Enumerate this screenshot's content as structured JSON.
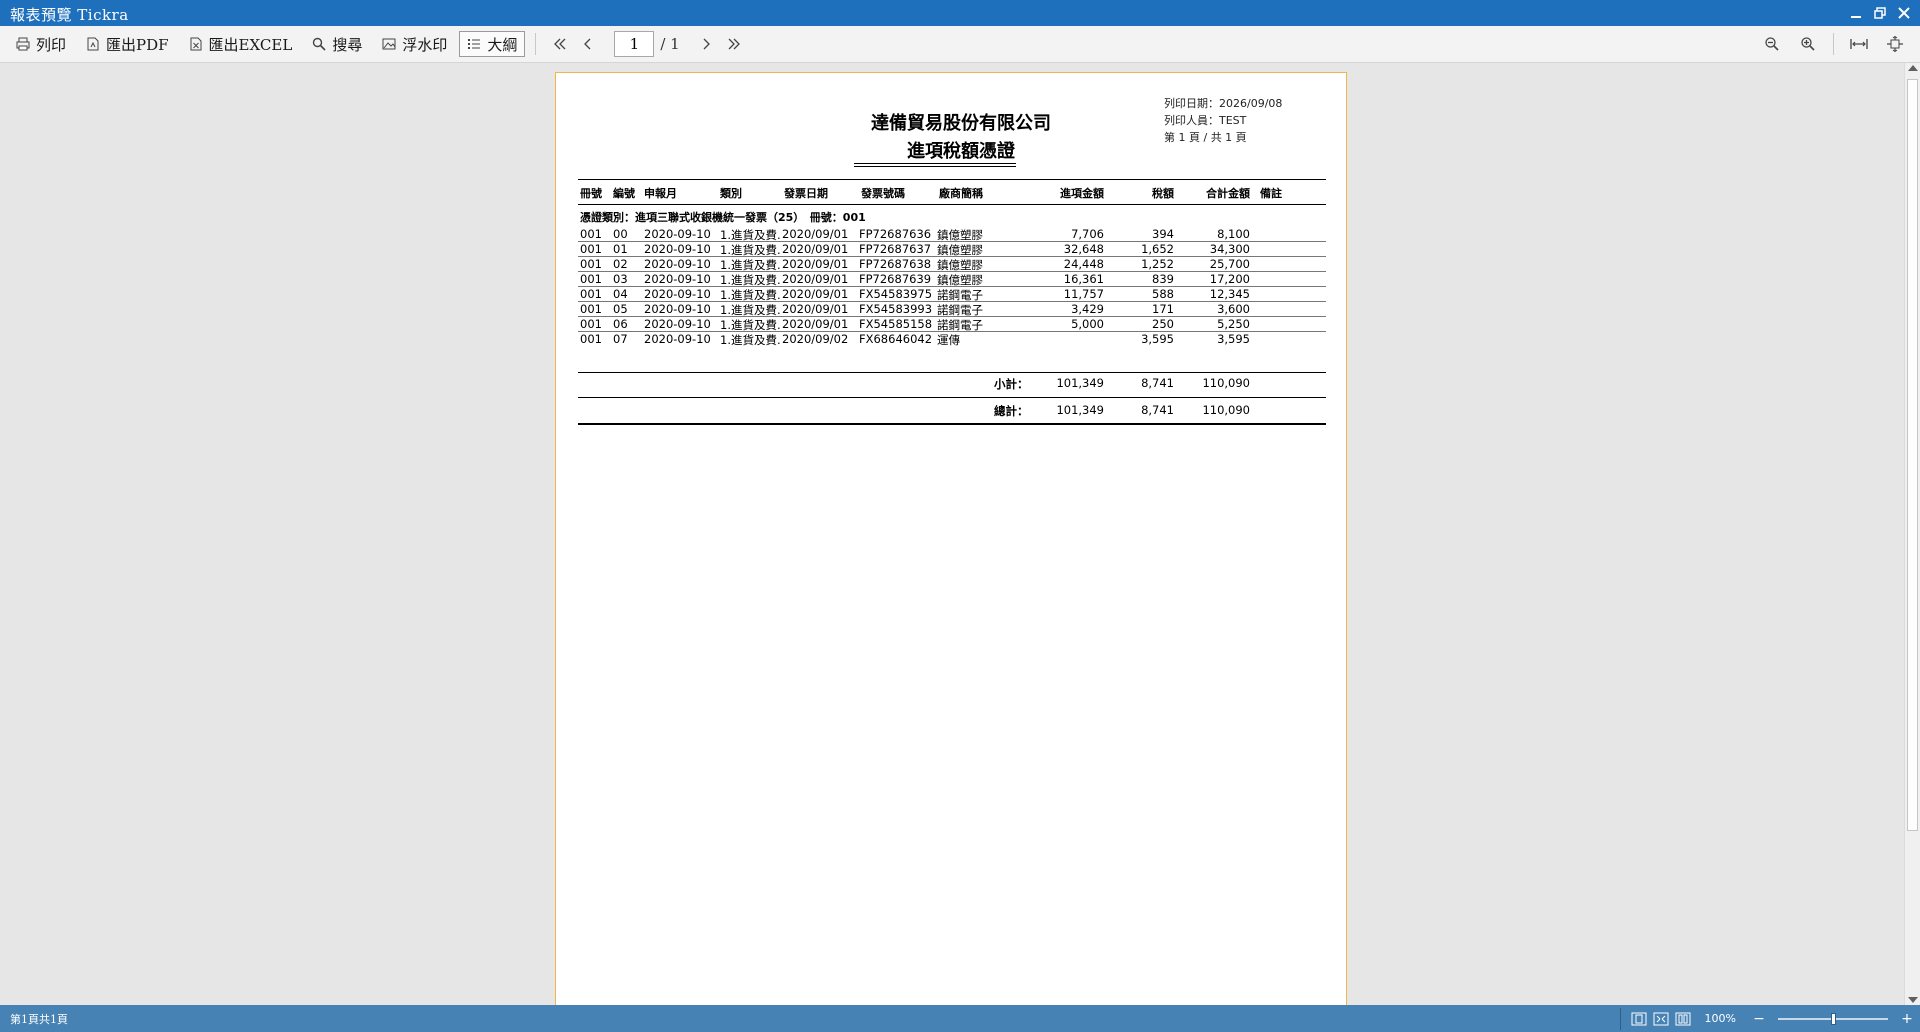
{
  "window": {
    "title": "報表預覽 Tickra"
  },
  "toolbar": {
    "print": "列印",
    "export_pdf": "匯出PDF",
    "export_excel": "匯出EXCEL",
    "search": "搜尋",
    "watermark": "浮水印",
    "outline": "大綱",
    "page_current": "1",
    "page_total": "/ 1"
  },
  "report": {
    "company": "達備貿易股份有限公司",
    "doc_title": "進項稅額憑證",
    "print_date": "列印日期：2026/09/08",
    "printed_by": "列印人員：TEST",
    "page_info": "第 1 頁 / 共 1 頁",
    "headers": {
      "book_no": "冊號",
      "serial": "編號",
      "period": "申報月",
      "category": "類別",
      "invoice_date": "發票日期",
      "invoice_no": "發票號碼",
      "vendor": "廠商簡稱",
      "amount": "進項金額",
      "tax": "稅額",
      "total": "合計金額",
      "remark": "備註"
    },
    "group_label": "憑證類別：進項三聯式收銀機統一發票（25）　冊號：001",
    "rows": [
      {
        "book": "001",
        "serial": "00",
        "period": "2020-09-10",
        "category": "1.進貨及費.",
        "date": "2020/09/01",
        "invoice": "FP72687636",
        "vendor": "鎮億塑膠",
        "amount": "7,706",
        "tax": "394",
        "total": "8,100"
      },
      {
        "book": "001",
        "serial": "01",
        "period": "2020-09-10",
        "category": "1.進貨及費.",
        "date": "2020/09/01",
        "invoice": "FP72687637",
        "vendor": "鎮億塑膠",
        "amount": "32,648",
        "tax": "1,652",
        "total": "34,300"
      },
      {
        "book": "001",
        "serial": "02",
        "period": "2020-09-10",
        "category": "1.進貨及費.",
        "date": "2020/09/01",
        "invoice": "FP72687638",
        "vendor": "鎮億塑膠",
        "amount": "24,448",
        "tax": "1,252",
        "total": "25,700"
      },
      {
        "book": "001",
        "serial": "03",
        "period": "2020-09-10",
        "category": "1.進貨及費.",
        "date": "2020/09/01",
        "invoice": "FP72687639",
        "vendor": "鎮億塑膠",
        "amount": "16,361",
        "tax": "839",
        "total": "17,200"
      },
      {
        "book": "001",
        "serial": "04",
        "period": "2020-09-10",
        "category": "1.進貨及費.",
        "date": "2020/09/01",
        "invoice": "FX54583975",
        "vendor": "諾鋼電子",
        "amount": "11,757",
        "tax": "588",
        "total": "12,345"
      },
      {
        "book": "001",
        "serial": "05",
        "period": "2020-09-10",
        "category": "1.進貨及費.",
        "date": "2020/09/01",
        "invoice": "FX54583993",
        "vendor": "諾鋼電子",
        "amount": "3,429",
        "tax": "171",
        "total": "3,600"
      },
      {
        "book": "001",
        "serial": "06",
        "period": "2020-09-10",
        "category": "1.進貨及費.",
        "date": "2020/09/01",
        "invoice": "FX54585158",
        "vendor": "諾鋼電子",
        "amount": "5,000",
        "tax": "250",
        "total": "5,250"
      },
      {
        "book": "001",
        "serial": "07",
        "period": "2020-09-10",
        "category": "1.進貨及費.",
        "date": "2020/09/02",
        "invoice": "FX68646042",
        "vendor": "運傳",
        "amount": "",
        "tax": "3,595",
        "total": "3,595"
      }
    ],
    "subtotal": {
      "label": "小計：",
      "amount": "101,349",
      "tax": "8,741",
      "total": "110,090"
    },
    "grand_total": {
      "label": "總計：",
      "amount": "101,349",
      "tax": "8,741",
      "total": "110,090"
    }
  },
  "status": {
    "page_text": "第1頁共1頁",
    "zoom": "100%",
    "zoom_minus": "−",
    "zoom_plus": "+",
    "zoom_level": 0.5
  }
}
